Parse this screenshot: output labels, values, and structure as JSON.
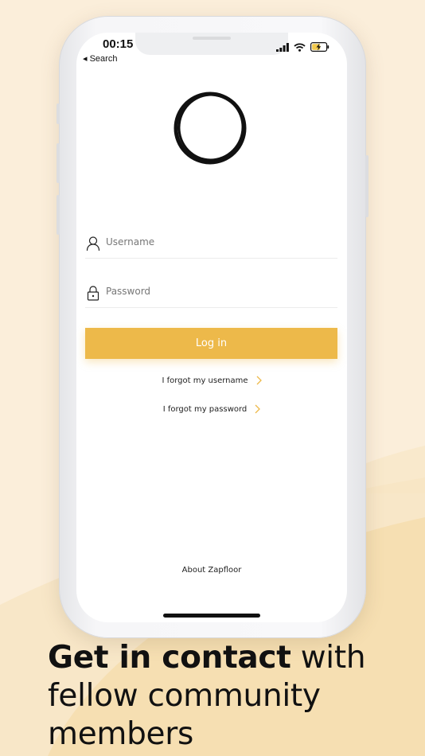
{
  "status_bar": {
    "time": "00:15",
    "back_label": "◂ Search"
  },
  "login_form": {
    "username_placeholder": "Username",
    "password_placeholder": "Password",
    "login_label": "Log in",
    "forgot_username_label": "I forgot my username",
    "forgot_password_label": "I forgot my password",
    "about_label": "About Zapfloor"
  },
  "headline": {
    "bold_text": "Get in contact",
    "rest_line1": " with",
    "line2": "fellow community",
    "line3": "members"
  },
  "colors": {
    "accent": "#edb94a",
    "background": "#fbeeda",
    "wave": "#f6dfb2"
  },
  "icons": {
    "logo": "ring-logo-icon",
    "username": "user-icon",
    "password": "lock-icon",
    "chevron": "chevron-right-icon"
  }
}
